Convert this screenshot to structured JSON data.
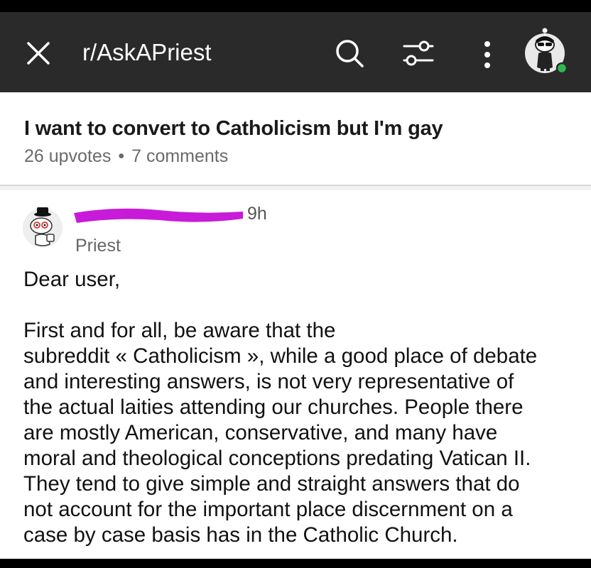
{
  "header": {
    "close_icon": "close-icon",
    "subreddit": "r/AskAPriest",
    "search_icon": "search-icon",
    "filter_icon": "filter-icon",
    "more_icon": "more-vertical-icon",
    "avatar_icon": "user-avatar"
  },
  "post": {
    "title": "I want to convert to Catholicism but I'm gay",
    "upvotes": "26 upvotes",
    "separator": "•",
    "comments": "7 comments"
  },
  "comment": {
    "time": "9h",
    "flair": "Priest",
    "greeting": "Dear user,",
    "paragraph_lines": [
      "First and for all, be aware that the",
      "subreddit « Catholicism », while a good place of debate",
      "and interesting answers, is not very representative of",
      "the actual laities attending our churches. People there",
      "are mostly American, conservative, and many have",
      "moral and theological conceptions predating Vatican II.",
      "They tend to give simple and straight answers that do",
      "not account for the important place discernment on a",
      "case by case basis has in the Catholic Church."
    ]
  },
  "colors": {
    "topbar": "#2a2a2a",
    "online_dot": "#2fb851",
    "redaction": "#c81ad9",
    "meta_text": "#6a6a6a"
  }
}
